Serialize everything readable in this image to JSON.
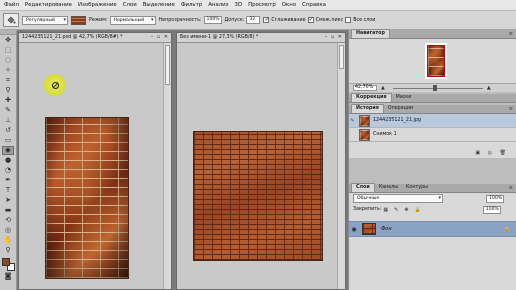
{
  "menu": [
    "Файл",
    "Редактирование",
    "Изображение",
    "Слои",
    "Выделение",
    "Фильтр",
    "Анализ",
    "3D",
    "Просмотр",
    "Окно",
    "Справка"
  ],
  "options": {
    "preset_dropdown": "Регулярный",
    "mode_label": "Режим:",
    "mode_value": "Нормальный",
    "opacity_label": "Непрозрачность:",
    "opacity_value": "100%",
    "tolerance_label": "Допуск:",
    "tolerance_value": "32",
    "smoothing_label": "Сглаживание",
    "contiguous_label": "Смеж.пикс",
    "all_layers_label": "Все слои"
  },
  "docs": [
    {
      "title": "1244235121_21.psd @ 42,7% (RGB/8#) *",
      "controls": "– ▫ ✕"
    },
    {
      "title": "Без имени-1 @ 27,3% (RGB/8) *",
      "controls": "– ▫ ✕"
    }
  ],
  "panels": {
    "navigator_tab": "Навигатор",
    "navigator_zoom": "42,70%",
    "correction_tabs": [
      "Коррекция",
      "Маски"
    ],
    "history_tabs": [
      "История",
      "Операции"
    ],
    "history_items": [
      {
        "label": "1244235121_21.jpg"
      },
      {
        "label": "Снимок 1"
      }
    ],
    "layer_tabs": [
      "Слои",
      "Каналы",
      "Контуры"
    ],
    "blend_mode": "Обычные",
    "opacity": "100%",
    "lock_label": "Закрепить:",
    "fill": "100%",
    "layer_name": "Фон"
  },
  "icons": {
    "cursor": "fill-cursor-icon",
    "eye": "eye-icon",
    "lock": "lock-icon"
  },
  "colors": {
    "highlight_cursor": "#d9de3c",
    "layer_selected": "#8aa3c4",
    "history_selected": "#b9c9dd"
  }
}
